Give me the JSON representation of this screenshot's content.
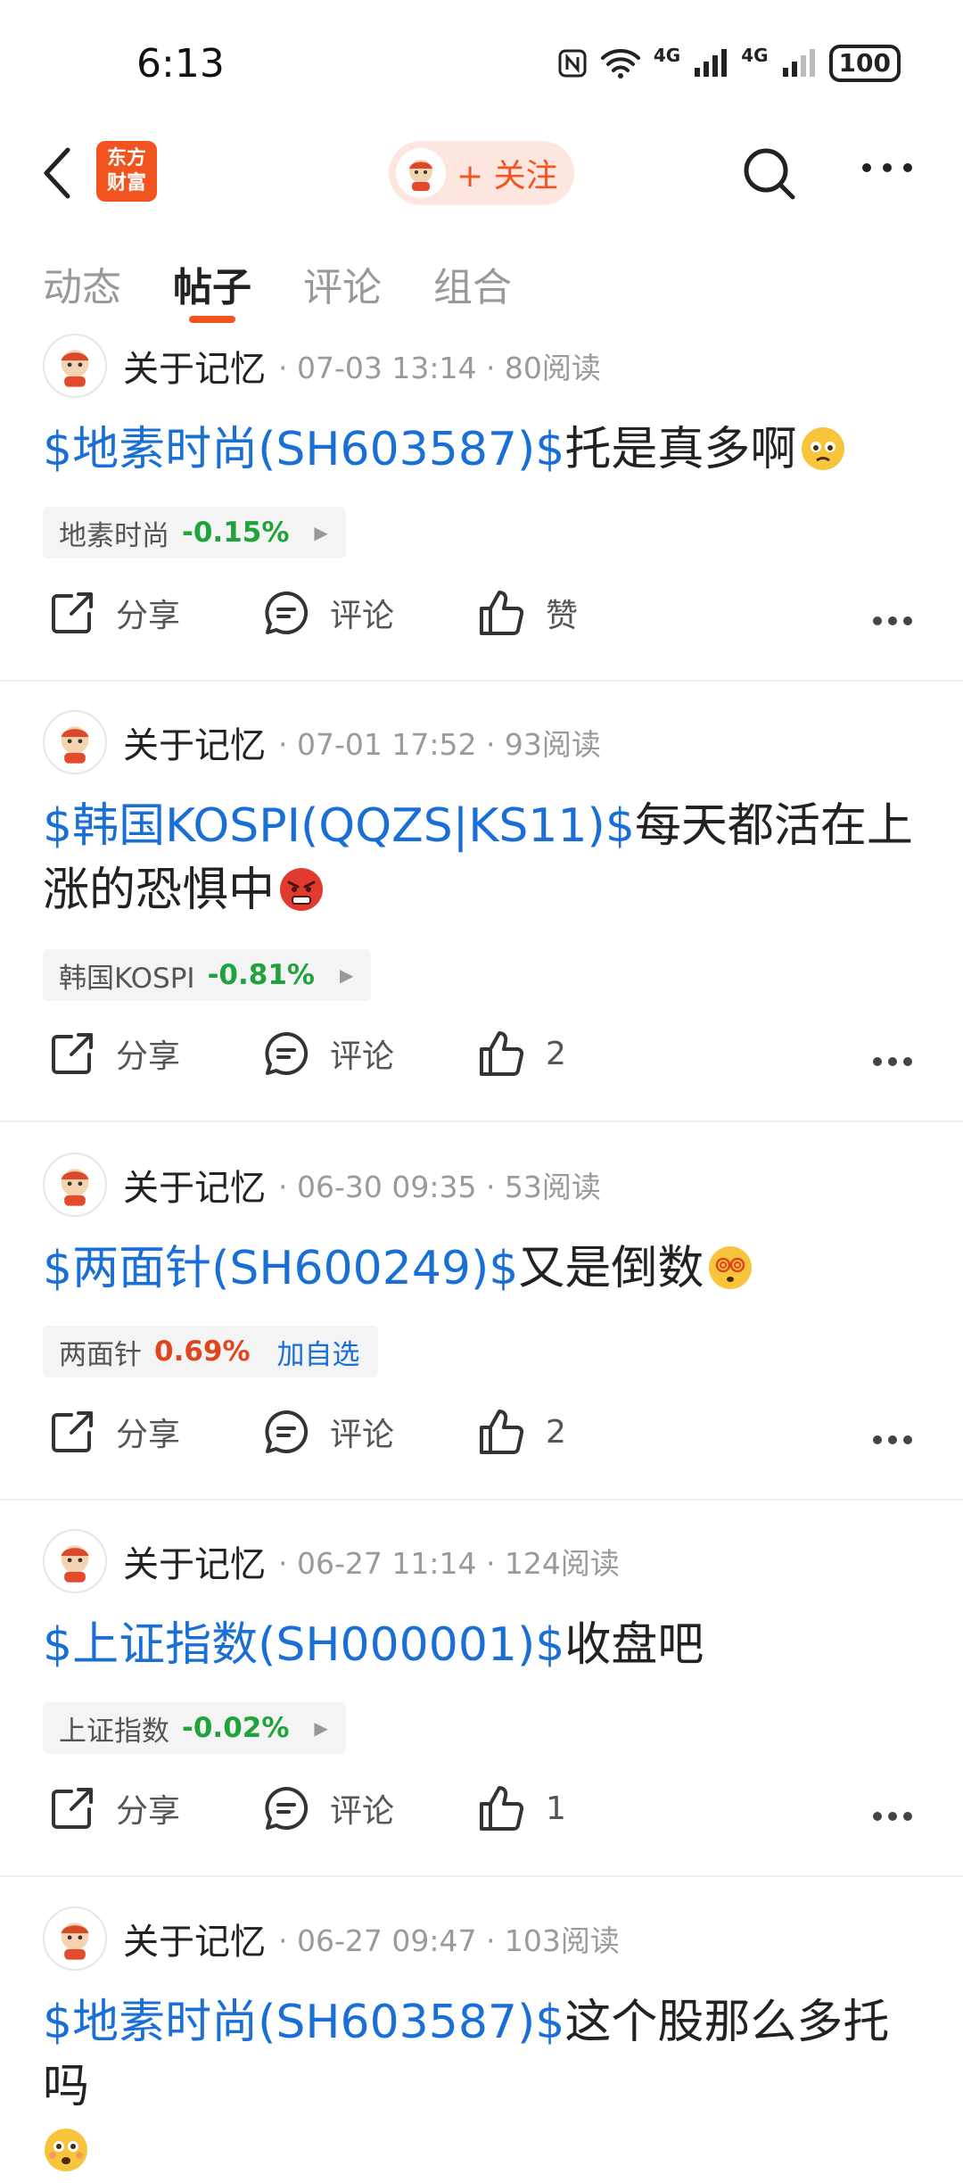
{
  "status": {
    "time": "6:13",
    "net1": "4G",
    "net2": "4G",
    "battery": "100"
  },
  "nav": {
    "logo_line1": "东方",
    "logo_line2": "财富",
    "follow_label": "+ 关注"
  },
  "tabs": [
    "动态",
    "帖子",
    "评论",
    "组合"
  ],
  "posts": [
    {
      "author": "关于记忆",
      "meta": "· 07-03 13:14 · 80阅读",
      "stock_link": "$地素时尚(SH603587)$",
      "text": "托是真多啊",
      "tag_name": "地素时尚",
      "tag_change": "-0.15%",
      "share": "分享",
      "comment": "评论",
      "like": "赞"
    },
    {
      "author": "关于记忆",
      "meta": "· 07-01 17:52 · 93阅读",
      "stock_link": "$韩国KOSPI(QQZS|KS11)$",
      "text": "每天都活在上涨的恐惧中",
      "tag_name": "韩国KOSPI",
      "tag_change": "-0.81%",
      "share": "分享",
      "comment": "评论",
      "like": "2"
    },
    {
      "author": "关于记忆",
      "meta": "· 06-30 09:35 · 53阅读",
      "stock_link": "$两面针(SH600249)$",
      "text": "又是倒数",
      "tag_name": "两面针",
      "tag_change": "0.69%",
      "tag_add": "加自选",
      "share": "分享",
      "comment": "评论",
      "like": "2"
    },
    {
      "author": "关于记忆",
      "meta": "· 06-27 11:14 · 124阅读",
      "stock_link": "$上证指数(SH000001)$",
      "text": "收盘吧",
      "tag_name": "上证指数",
      "tag_change": "-0.02%",
      "share": "分享",
      "comment": "评论",
      "like": "1"
    },
    {
      "author": "关于记忆",
      "meta": "· 06-27 09:47 · 103阅读",
      "stock_link": "$地素时尚(SH603587)$",
      "text": "这个股那么多托吗"
    }
  ],
  "colors": {
    "brand": "#f2541f",
    "link": "#1a6fd6",
    "down": "#20a33a",
    "up": "#e0461e"
  },
  "icons": [
    "back-icon",
    "search-icon",
    "more-icon",
    "share-icon",
    "comment-icon",
    "like-icon"
  ]
}
